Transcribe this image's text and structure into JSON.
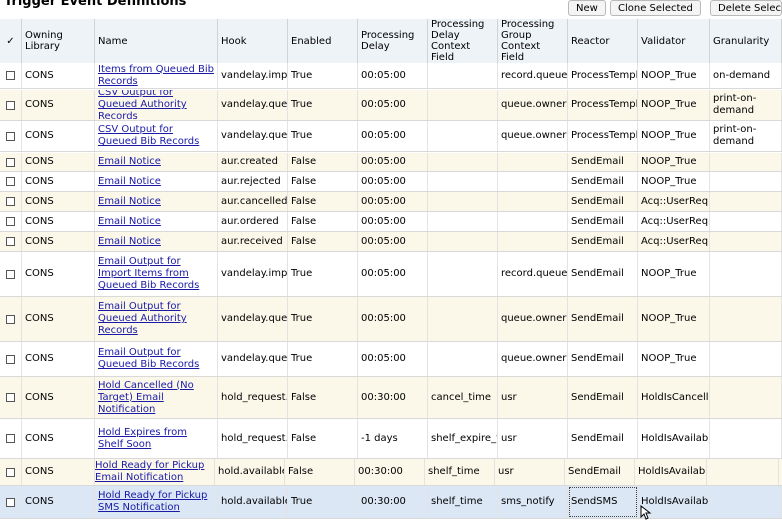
{
  "page_title": "Trigger Event Definitions",
  "toolbar": {
    "new_label": "New",
    "clone_label": "Clone Selected",
    "delete_label": "Delete Selected"
  },
  "columns": {
    "select": "✓",
    "owning_library": "Owning Library",
    "name": "Name",
    "hook": "Hook",
    "enabled": "Enabled",
    "processing_delay": "Processing Delay",
    "delay_context_field": "Processing Delay Context Field",
    "group_context_field": "Processing Group Context Field",
    "reactor": "Reactor",
    "validator": "Validator",
    "granularity": "Granularity"
  },
  "colors": {
    "header_bg": "#eef3f8",
    "row_alt_bg": "#fbf8ea",
    "selected_bg": "#dbe7f5",
    "link": "#1a1aa6"
  },
  "rows": [
    {
      "lib": "CONS",
      "name": "Items from Queued Bib Records",
      "hook": "vandelay.impo",
      "enabled": "True",
      "delay": "00:05:00",
      "delay_field": "",
      "group_field": "record.queue.",
      "reactor": "ProcessTempl",
      "validator": "NOOP_True",
      "granularity": "on-demand"
    },
    {
      "lib": "CONS",
      "name": "CSV Output for Queued Authority Records",
      "hook": "vandelay.queu",
      "enabled": "True",
      "delay": "00:05:00",
      "delay_field": "",
      "group_field": "queue.owner",
      "reactor": "ProcessTempl",
      "validator": "NOOP_True",
      "granularity": "print-on-demand"
    },
    {
      "lib": "CONS",
      "name": "CSV Output for Queued Bib Records",
      "hook": "vandelay.queu",
      "enabled": "True",
      "delay": "00:05:00",
      "delay_field": "",
      "group_field": "queue.owner",
      "reactor": "ProcessTempl",
      "validator": "NOOP_True",
      "granularity": "print-on-demand"
    },
    {
      "lib": "CONS",
      "name": "Email Notice",
      "hook": "aur.created",
      "enabled": "False",
      "delay": "00:05:00",
      "delay_field": "",
      "group_field": "",
      "reactor": "SendEmail",
      "validator": "NOOP_True",
      "granularity": ""
    },
    {
      "lib": "CONS",
      "name": "Email Notice",
      "hook": "aur.rejected",
      "enabled": "False",
      "delay": "00:05:00",
      "delay_field": "",
      "group_field": "",
      "reactor": "SendEmail",
      "validator": "NOOP_True",
      "granularity": ""
    },
    {
      "lib": "CONS",
      "name": "Email Notice",
      "hook": "aur.cancelled",
      "enabled": "False",
      "delay": "00:05:00",
      "delay_field": "",
      "group_field": "",
      "reactor": "SendEmail",
      "validator": "Acq::UserReq",
      "granularity": ""
    },
    {
      "lib": "CONS",
      "name": "Email Notice",
      "hook": "aur.ordered",
      "enabled": "False",
      "delay": "00:05:00",
      "delay_field": "",
      "group_field": "",
      "reactor": "SendEmail",
      "validator": "Acq::UserReq",
      "granularity": ""
    },
    {
      "lib": "CONS",
      "name": "Email Notice",
      "hook": "aur.received",
      "enabled": "False",
      "delay": "00:05:00",
      "delay_field": "",
      "group_field": "",
      "reactor": "SendEmail",
      "validator": "Acq::UserReq",
      "granularity": ""
    },
    {
      "lib": "CONS",
      "name": "Email Output for Import Items from Queued Bib Records",
      "hook": "vandelay.impo",
      "enabled": "True",
      "delay": "00:05:00",
      "delay_field": "",
      "group_field": "record.queue.",
      "reactor": "SendEmail",
      "validator": "NOOP_True",
      "granularity": ""
    },
    {
      "lib": "CONS",
      "name": "Email Output for Queued Authority Records",
      "hook": "vandelay.queu",
      "enabled": "True",
      "delay": "00:05:00",
      "delay_field": "",
      "group_field": "queue.owner",
      "reactor": "SendEmail",
      "validator": "NOOP_True",
      "granularity": ""
    },
    {
      "lib": "CONS",
      "name": "Email Output for Queued Bib Records",
      "hook": "vandelay.queu",
      "enabled": "True",
      "delay": "00:05:00",
      "delay_field": "",
      "group_field": "queue.owner",
      "reactor": "SendEmail",
      "validator": "NOOP_True",
      "granularity": ""
    },
    {
      "lib": "CONS",
      "name": "Hold Cancelled (No Target) Email Notification",
      "hook": "hold_request.c",
      "enabled": "False",
      "delay": "00:30:00",
      "delay_field": "cancel_time",
      "group_field": "usr",
      "reactor": "SendEmail",
      "validator": "HoldIsCancelle",
      "granularity": ""
    },
    {
      "lib": "CONS",
      "name": "Hold Expires from Shelf Soon",
      "hook": "hold_request.s",
      "enabled": "False",
      "delay": "-1 days",
      "delay_field": "shelf_expire_ti",
      "group_field": "usr",
      "reactor": "SendEmail",
      "validator": "HoldIsAvailabl",
      "granularity": ""
    },
    {
      "lib": "CONS",
      "name": "Hold Ready for Pickup Email Notification",
      "hook": "hold.available",
      "enabled": "False",
      "delay": "00:30:00",
      "delay_field": "shelf_time",
      "group_field": "usr",
      "reactor": "SendEmail",
      "validator": "HoldIsAvailabl",
      "granularity": ""
    },
    {
      "lib": "CONS",
      "name": "Hold Ready for Pickup SMS Notification",
      "hook": "hold.available",
      "enabled": "True",
      "delay": "00:30:00",
      "delay_field": "shelf_time",
      "group_field": "sms_notify",
      "reactor": "SendSMS",
      "validator": "HoldIsAvailabl",
      "granularity": ""
    }
  ]
}
